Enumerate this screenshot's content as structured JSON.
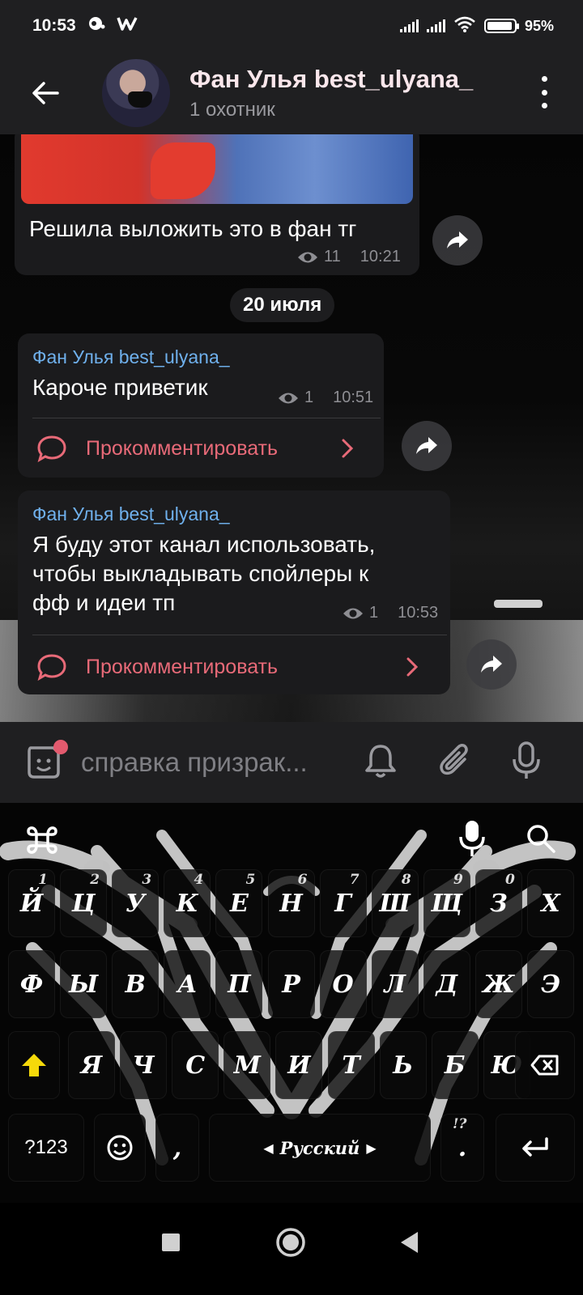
{
  "status_bar": {
    "time": "10:53",
    "battery": "95",
    "battery_level": 0.95,
    "icons": [
      "notification-icon",
      "w-app-icon",
      "signal-icon",
      "signal-icon",
      "wifi-icon",
      "battery-icon"
    ]
  },
  "header": {
    "channel_name": "Фан Улья best_ulyana_",
    "subscribers": "1 охотник"
  },
  "messages": [
    {
      "text": "Решила выложить это в фан тг",
      "views": "11",
      "time": "10:21"
    },
    {
      "author": "Фан Улья best_ulyana_",
      "text": "Кароче приветик",
      "views": "1",
      "time": "10:51",
      "comment_label": "Прокомментировать"
    },
    {
      "author": "Фан Улья best_ulyana_",
      "text_lines": [
        "Я буду этот канал использовать,",
        "чтобы выкладывать спойлеры к",
        "фф и идеи тп"
      ],
      "views": "1",
      "time": "10:53",
      "comment_label": "Прокомментировать"
    }
  ],
  "date_separator": "20 июля",
  "composer": {
    "placeholder": "справка призрак..."
  },
  "keyboard": {
    "row1": [
      {
        "k": "Й",
        "h": "1"
      },
      {
        "k": "Ц",
        "h": "2"
      },
      {
        "k": "У",
        "h": "3"
      },
      {
        "k": "К",
        "h": "4"
      },
      {
        "k": "Е",
        "h": "5"
      },
      {
        "k": "Н",
        "h": "6"
      },
      {
        "k": "Г",
        "h": "7"
      },
      {
        "k": "Ш",
        "h": "8"
      },
      {
        "k": "Щ",
        "h": "9"
      },
      {
        "k": "З",
        "h": "0"
      },
      {
        "k": "Х",
        "h": ""
      }
    ],
    "row2": [
      "Ф",
      "Ы",
      "В",
      "А",
      "П",
      "Р",
      "О",
      "Л",
      "Д",
      "Ж",
      "Э"
    ],
    "row3": [
      "Я",
      "Ч",
      "С",
      "М",
      "И",
      "Т",
      "Ь",
      "Б",
      "Ю"
    ],
    "symbols_key": "?123",
    "comma_key": ",",
    "period_key": ".",
    "period_hint": "!?",
    "language_label": "Русский",
    "shift_color": "#f5d90a"
  },
  "colors": {
    "author": "#6fb0ec",
    "comment": "#e86a78",
    "header_bg": "#1f1f21"
  }
}
